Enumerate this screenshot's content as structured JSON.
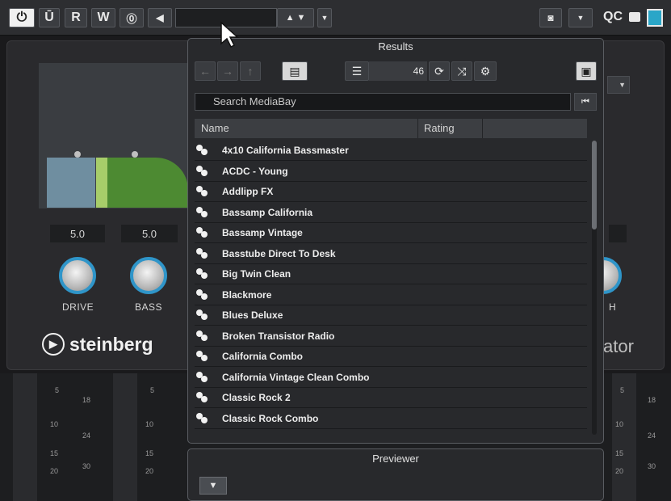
{
  "toolbar": {
    "read_label": "R",
    "write_label": "W",
    "qc_label": "QC",
    "accent": "#2aa6c8"
  },
  "plugin": {
    "knobs": [
      {
        "label": "DRIVE",
        "value": "5.0"
      },
      {
        "label": "BASS",
        "value": "5.0"
      }
    ],
    "brand": "steinberg",
    "brand_right": "ator",
    "knob_right_label": "H"
  },
  "mediabay": {
    "results_title": "Results",
    "count": "46",
    "search_placeholder": "Search MediaBay",
    "columns": [
      "Name",
      "Rating"
    ],
    "items": [
      "4x10 California Bassmaster",
      "ACDC - Young",
      "Addlipp FX",
      "Bassamp California",
      "Bassamp Vintage",
      "Basstube Direct To Desk",
      "Big Twin Clean",
      "Blackmore",
      "Blues Deluxe",
      "Broken Transistor Radio",
      "California Combo",
      "California Vintage Clean Combo",
      "Classic Rock 2",
      "Classic Rock Combo"
    ]
  },
  "previewer": {
    "title": "Previewer"
  },
  "meters": {
    "scale": [
      "5",
      "10",
      "15",
      "20"
    ],
    "scale2": [
      "18",
      "24",
      "30"
    ]
  }
}
